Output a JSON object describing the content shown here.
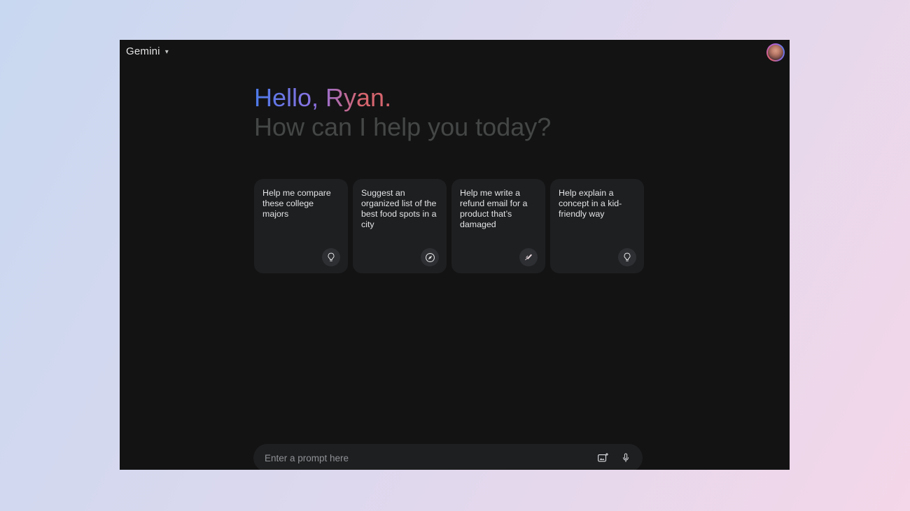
{
  "page": {
    "background_gradient": [
      "#c8d8f0",
      "#dcd8ee",
      "#f4d7e9"
    ]
  },
  "window": {
    "background": "#131314",
    "card_background": "#1e1f20"
  },
  "topbar": {
    "app_title": "Gemini",
    "caret_glyph": "▾"
  },
  "greeting": {
    "headline": "Hello, Ryan.",
    "subline": "How can I help you today?",
    "headline_gradient": [
      "#4c7ae8",
      "#8e72e2",
      "#d6656e"
    ],
    "subline_color": "#444746"
  },
  "suggestions": [
    {
      "text": "Help me compare these college majors",
      "icon": "lightbulb-icon"
    },
    {
      "text": "Suggest an organized list of the best food spots in a city",
      "icon": "compass-icon"
    },
    {
      "text": "Help me write a refund email for a product that’s damaged",
      "icon": "pen-icon"
    },
    {
      "text": "Help explain a concept in a kid-friendly way",
      "icon": "lightbulb-icon"
    }
  ],
  "prompt_bar": {
    "placeholder": "Enter a prompt here",
    "icons": [
      "add-image-icon",
      "microphone-icon"
    ]
  }
}
